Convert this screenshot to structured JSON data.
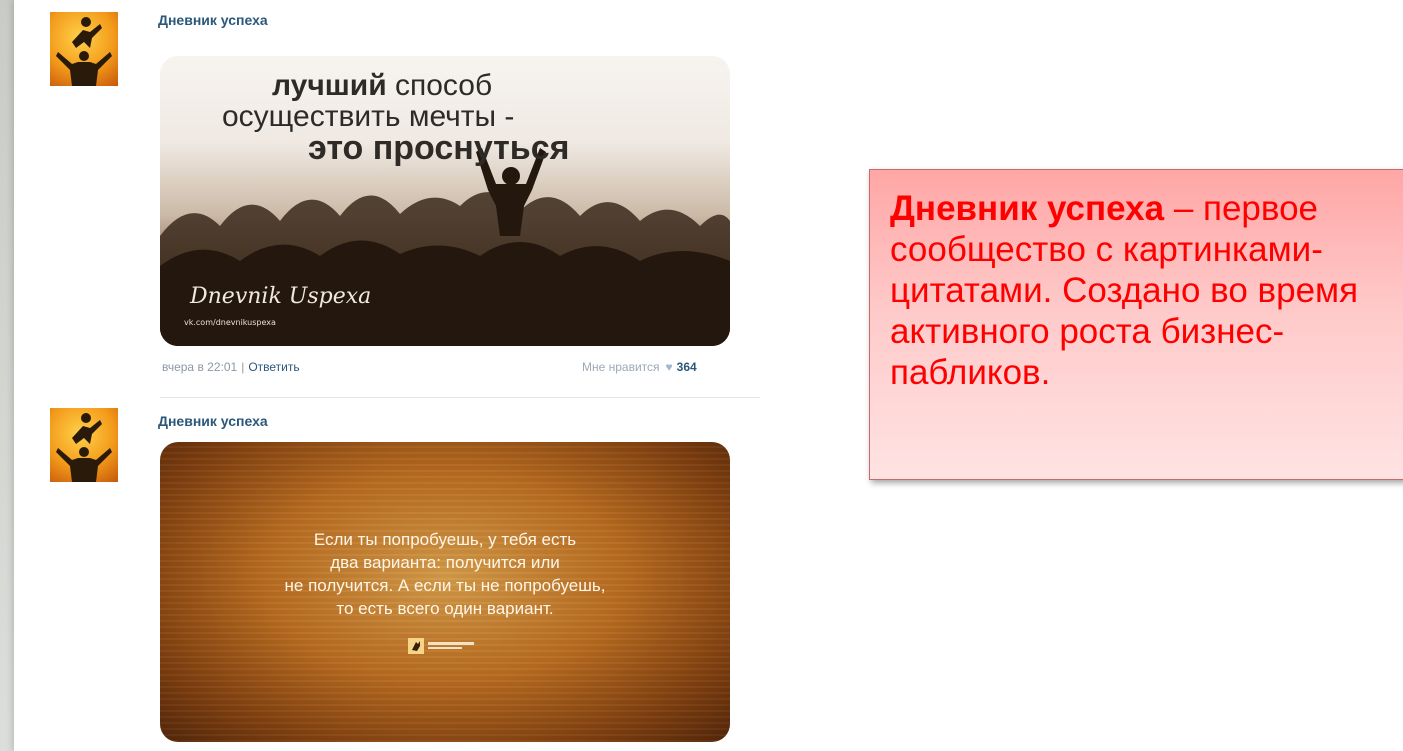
{
  "posts": [
    {
      "author": "Дневник успеха",
      "image_text": {
        "line1_bold": "лучший",
        "line1_rest": " способ",
        "line2": "осуществить мечты -",
        "line3": "это проснуться",
        "signature": "Dnevnik Uspexa",
        "signature_url": "vk.com/dnevnikuspexa"
      },
      "time": "вчера в 22:01",
      "separator": "|",
      "reply_label": "Ответить",
      "like_label": "Мне нравится",
      "like_icon": "heart-icon",
      "like_count": "364"
    },
    {
      "author": "Дневник успеха",
      "image_text": {
        "lines": [
          "Если ты попробуешь, у тебя есть",
          "два варианта: получится или",
          "не получится. А если ты не попробуешь,",
          "то есть всего один вариант."
        ]
      }
    }
  ],
  "callout": {
    "bold": "Дневник успеха",
    "lines": [
      " – первое",
      "сообщество с картинками-",
      "цитатами. Создано во время",
      "активного роста бизнес-",
      "пабликов."
    ]
  },
  "colors": {
    "link": "#2b587a",
    "callout_text": "#ff0000",
    "callout_bg": "#ffc9c9"
  }
}
